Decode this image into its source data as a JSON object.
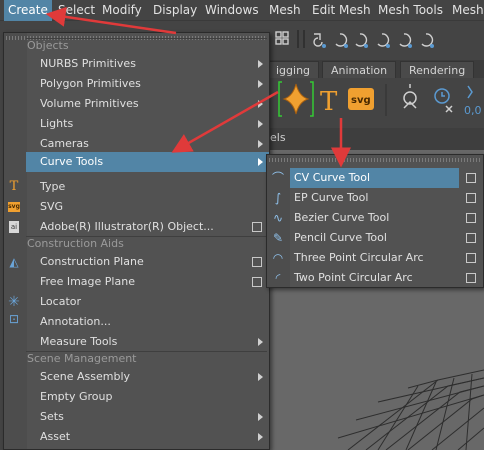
{
  "menubar": [
    "Create",
    "Select",
    "Modify",
    "Display",
    "Windows",
    "Mesh",
    "Edit Mesh",
    "Mesh Tools",
    "Mesh"
  ],
  "shelf_tabs": [
    "igging",
    "Animation",
    "Rendering"
  ],
  "panel_bar_text": "els",
  "create_menu": {
    "sections": {
      "objects": "Objects",
      "construction": "Construction Aids",
      "scene": "Scene Management"
    },
    "items": {
      "nurbs": "NURBS Primitives",
      "polygon": "Polygon Primitives",
      "volume": "Volume Primitives",
      "lights": "Lights",
      "cameras": "Cameras",
      "curve_tools": "Curve Tools",
      "type": "Type",
      "svg": "SVG",
      "illustrator": "Adobe(R) Illustrator(R) Object...",
      "construction_plane": "Construction Plane",
      "free_image_plane": "Free Image Plane",
      "locator": "Locator",
      "annotation": "Annotation...",
      "measure_tools": "Measure Tools",
      "scene_assembly": "Scene Assembly",
      "empty_group": "Empty Group",
      "sets": "Sets",
      "asset": "Asset"
    }
  },
  "curve_menu": {
    "items": [
      "CV Curve Tool",
      "EP Curve Tool",
      "Bezier Curve Tool",
      "Pencil Curve Tool",
      "Three Point Circular Arc",
      "Two Point Circular Arc"
    ]
  },
  "shelf_text": {
    "type_icon": "T",
    "svg_icon": "svg",
    "shelf_value": "0,0"
  },
  "colors": {
    "highlight": "#5285a6",
    "annotation_arrow": "#e03a3a"
  }
}
